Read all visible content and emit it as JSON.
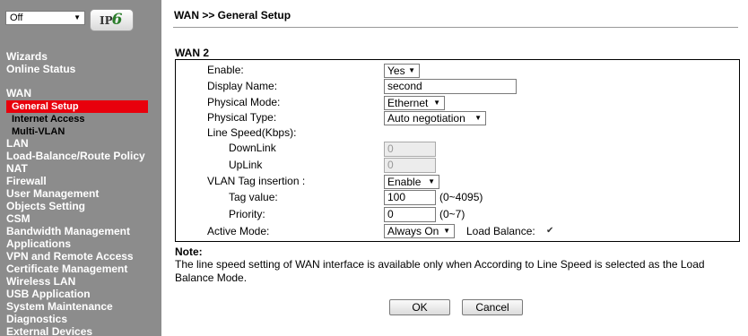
{
  "sidebar": {
    "mode_select": "Off",
    "ipv6_logo": {
      "text": "IP",
      "accent": "6"
    },
    "items": [
      {
        "label": "Wizards"
      },
      {
        "label": "Online Status"
      },
      {
        "label": "WAN"
      },
      {
        "label": "General Setup"
      },
      {
        "label": "Internet Access"
      },
      {
        "label": "Multi-VLAN"
      },
      {
        "label": "LAN"
      },
      {
        "label": "Load-Balance/Route Policy"
      },
      {
        "label": "NAT"
      },
      {
        "label": "Firewall"
      },
      {
        "label": "User Management"
      },
      {
        "label": "Objects Setting"
      },
      {
        "label": "CSM"
      },
      {
        "label": "Bandwidth Management"
      },
      {
        "label": "Applications"
      },
      {
        "label": "VPN and Remote Access"
      },
      {
        "label": "Certificate Management"
      },
      {
        "label": "Wireless LAN"
      },
      {
        "label": "USB Application"
      },
      {
        "label": "System Maintenance"
      },
      {
        "label": "Diagnostics"
      },
      {
        "label": "External Devices"
      }
    ],
    "active_color": "#e8000c",
    "background": "#8c8c8c"
  },
  "main": {
    "breadcrumb": "WAN >> General Setup",
    "section_title": "WAN 2",
    "form": {
      "enable_label": "Enable:",
      "enable_value": "Yes",
      "display_name_label": "Display Name:",
      "display_name_value": "second",
      "physical_mode_label": "Physical Mode:",
      "physical_mode_value": "Ethernet",
      "physical_type_label": "Physical Type:",
      "physical_type_value": "Auto negotiation",
      "line_speed_label": "Line Speed(Kbps):",
      "downlink_label": "DownLink",
      "downlink_value": "0",
      "uplink_label": "UpLink",
      "uplink_value": "0",
      "vlan_tag_label": "VLAN Tag insertion :",
      "vlan_tag_value": "Enable",
      "tag_value_label": "Tag value:",
      "tag_value": "100",
      "tag_range": "(0~4095)",
      "priority_label": "Priority:",
      "priority_value": "0",
      "priority_range": "(0~7)",
      "active_mode_label": "Active Mode:",
      "active_mode_value": "Always On",
      "load_balance_label": "Load Balance:",
      "load_balance_checked": true,
      "check_glyph": "✔"
    },
    "note_title": "Note:",
    "note_text": "The line speed setting of WAN interface is available only when According to Line Speed is selected as the Load Balance Mode.",
    "ok_label": "OK",
    "cancel_label": "Cancel"
  }
}
